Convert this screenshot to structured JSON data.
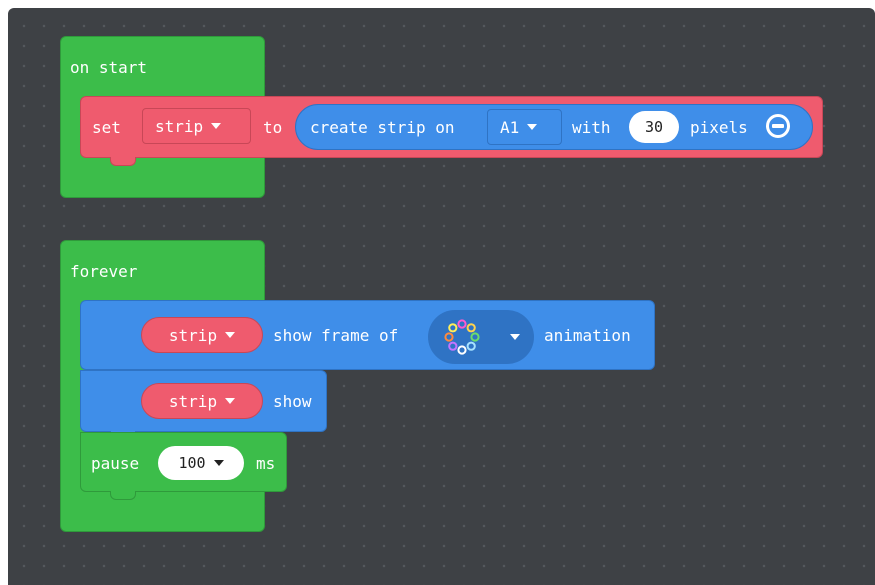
{
  "on_start": {
    "hat_label": "on start",
    "set_label": "set",
    "variable": "strip",
    "to_label": "to",
    "create_label": "create strip on",
    "pin": "A1",
    "with_label": "with",
    "pixel_count": "30",
    "pixels_label": "pixels"
  },
  "forever": {
    "hat_label": "forever",
    "show_frame": {
      "variable": "strip",
      "text_before": "show frame of",
      "text_after": "animation",
      "animation_icon": "rainbow-ring-icon",
      "ring_colors": [
        "#ff5ad0",
        "#ffd34d",
        "#6cdc6c",
        "#a6e1ff",
        "#ffffff",
        "#c275ff",
        "#ff8a3d",
        "#ffef5a"
      ]
    },
    "show": {
      "variable": "strip",
      "text": "show"
    },
    "pause": {
      "label": "pause",
      "value": "100",
      "unit": "ms"
    }
  },
  "colors": {
    "workspace": "#3e4145",
    "event_green": "#3cbd4a",
    "variables_pink": "#ef5b6e",
    "light_blue": "#3f8ee9"
  }
}
